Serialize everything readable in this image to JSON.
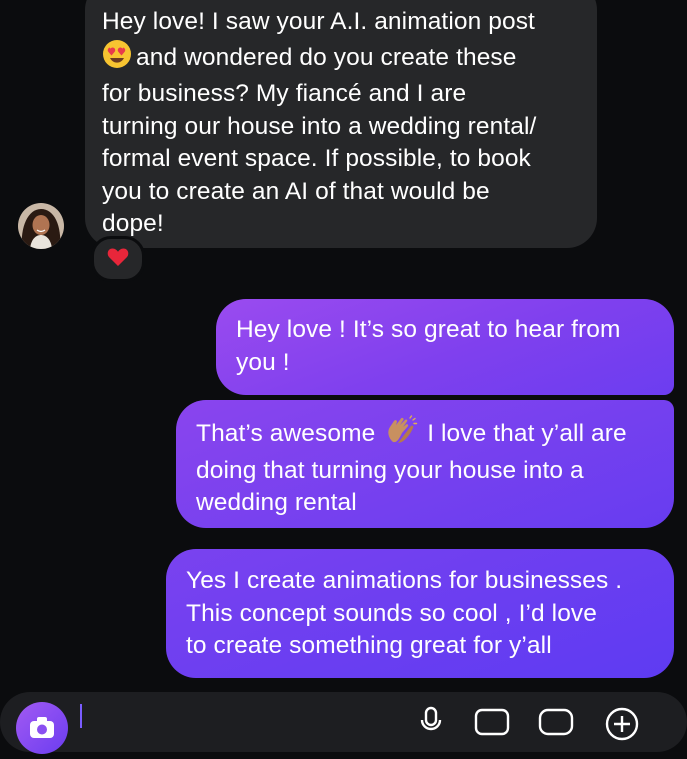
{
  "incoming": {
    "lines": [
      "Hey love! I saw your A.I. animation post",
      "and wondered do you create these",
      "for business? My fiancé and I are",
      "turning our house into a wedding rental/",
      "formal event space. If possible, to book",
      "you to create an AI of that would be",
      "dope!"
    ],
    "reaction": "heart-reaction",
    "inline_emoji": "heart-eyes-emoji"
  },
  "outgoing": [
    {
      "lines": [
        "Hey love ! It’s so great to hear from",
        "you !"
      ]
    },
    {
      "lines": [
        "That’s awesome",
        "I love that y’all are",
        "doing that turning your house into a",
        "wedding rental"
      ],
      "inline_emoji": "clapping-hands-emoji"
    },
    {
      "lines": [
        "Yes I create animations for businesses .",
        "This concept sounds so cool , I’d love",
        "to create something great for y’all"
      ]
    }
  ],
  "composer": {
    "icons": [
      "camera-icon",
      "microphone-icon",
      "gallery-icon",
      "sticker-icon",
      "add-icon"
    ]
  },
  "colors": {
    "background": "#0b0c0e",
    "incoming_bubble": "#262729",
    "outgoing_start": "#9a4bef",
    "outgoing_end": "#5e3bf2"
  }
}
